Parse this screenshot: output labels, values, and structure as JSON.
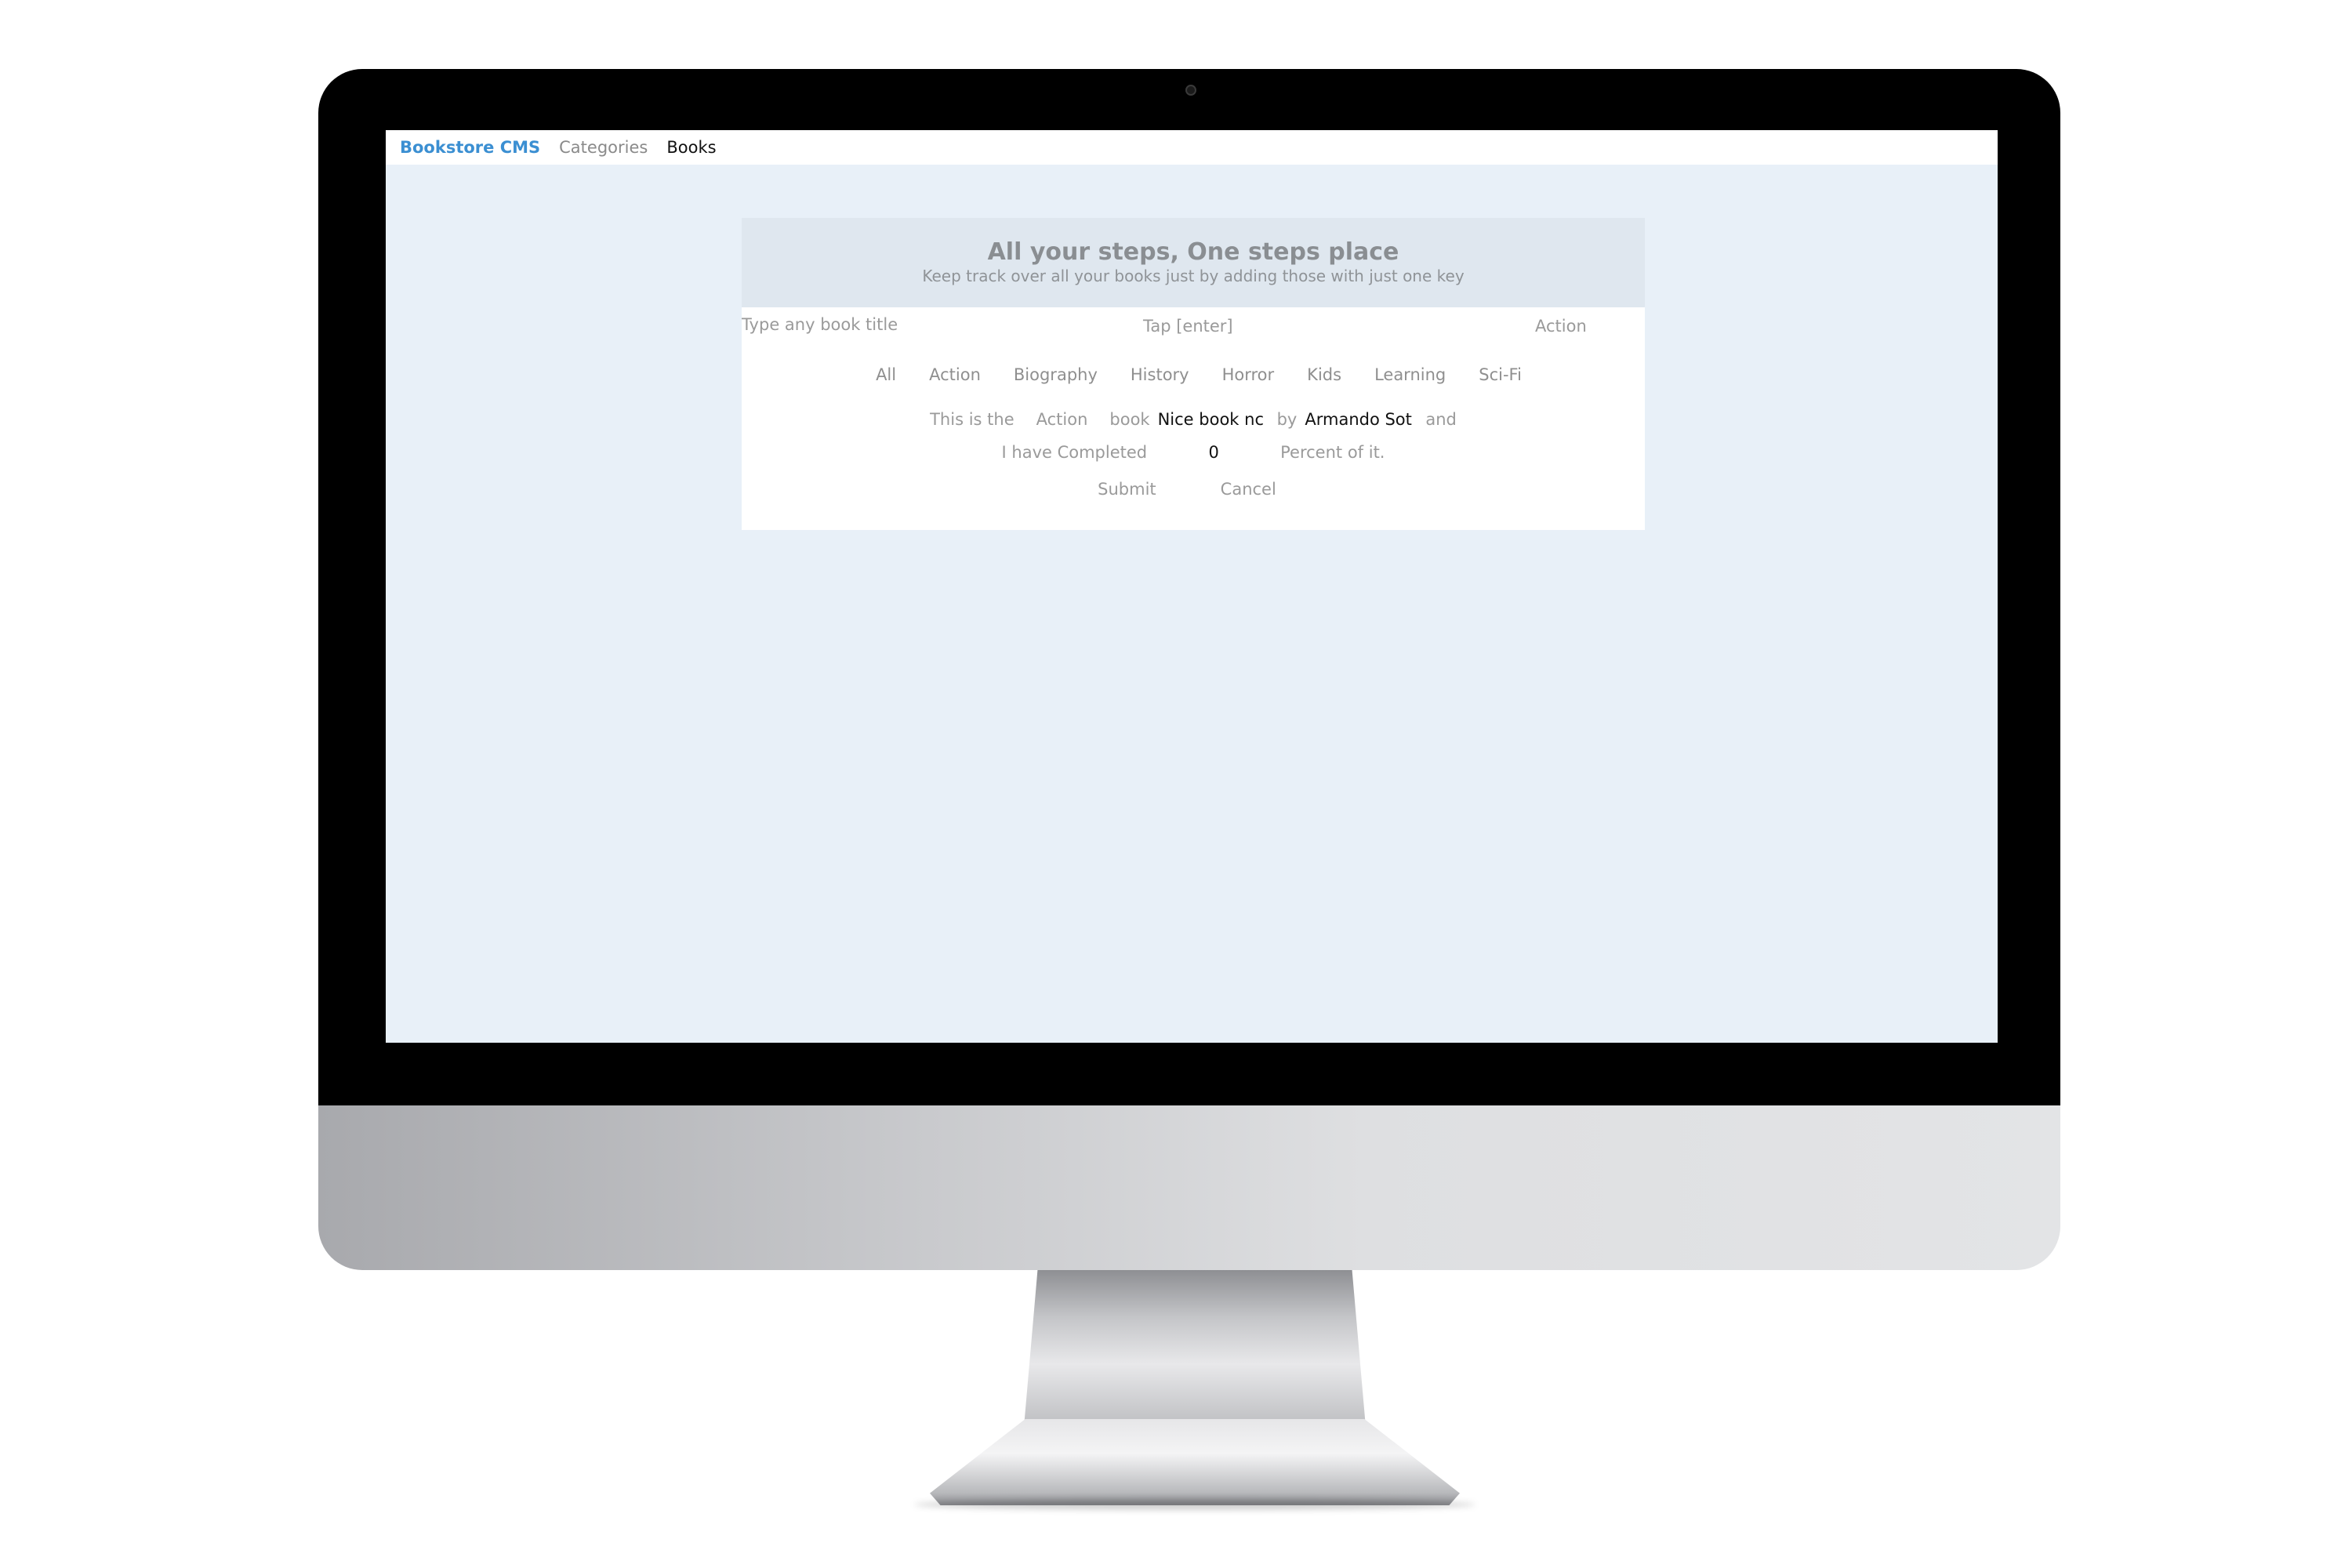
{
  "navbar": {
    "brand": "Bookstore CMS",
    "links": [
      "Categories",
      "Books"
    ]
  },
  "form": {
    "title": "All your steps, One steps place",
    "subtitle": "Keep track over all your books just by adding those with just one key",
    "title_placeholder": "Type any book title",
    "tap_hint": "Tap [enter]",
    "category_select_value": "Action",
    "categories": [
      "All",
      "Action",
      "Biography",
      "History",
      "Horror",
      "Kids",
      "Learning",
      "Sci-Fi"
    ],
    "sentence": {
      "part1": "This is the",
      "category": "Action",
      "part2": "book",
      "book_title": "Nice book nc",
      "part3": "by",
      "author": "Armando Sot",
      "part4": "and",
      "part5": "I have Completed",
      "percent": "0",
      "part6": "Percent of it."
    },
    "submit_label": "Submit",
    "cancel_label": "Cancel"
  },
  "colors": {
    "brand": "#3b8fd2",
    "screen_background": "#e8f0f8",
    "header_background": "#dfe7ef"
  }
}
